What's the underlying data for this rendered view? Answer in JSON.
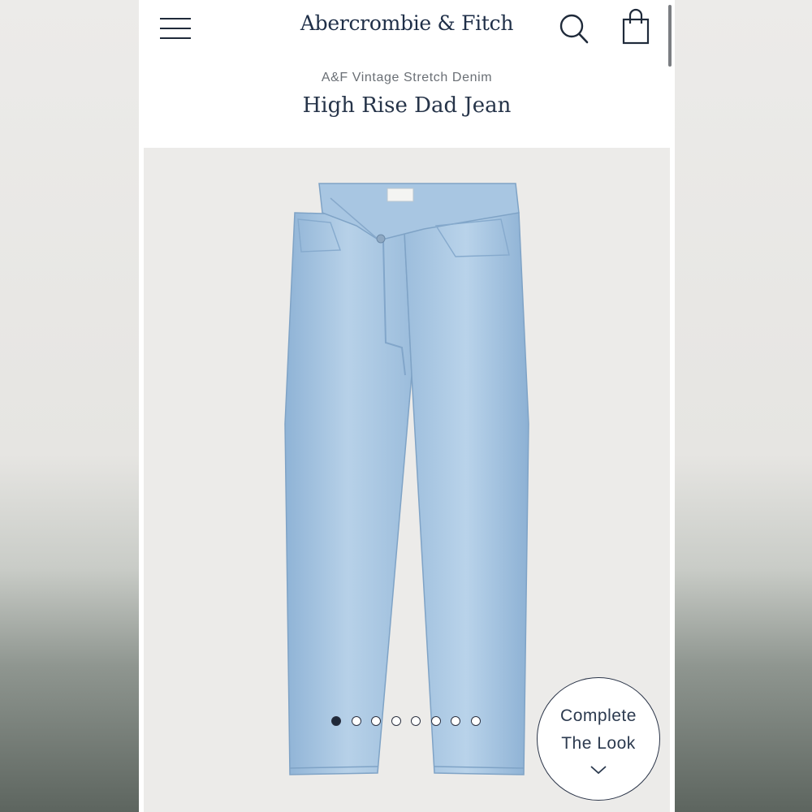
{
  "header": {
    "logo": "Abercrombie & Fitch",
    "menu_icon": "hamburger-menu-icon",
    "search_icon": "search-icon",
    "bag_icon": "shopping-bag-icon"
  },
  "product": {
    "collection": "A&F Vintage Stretch Denim",
    "name": "High Rise Dad Jean"
  },
  "gallery": {
    "image": "light-wash-jeans-image",
    "slide_count": 8,
    "active_slide": 1
  },
  "complete_look": {
    "line1": "Complete",
    "line2": "The Look",
    "icon": "chevron-down-icon"
  },
  "colors": {
    "brand_navy": "#1f2f48",
    "denim": "#a9c6e0"
  }
}
